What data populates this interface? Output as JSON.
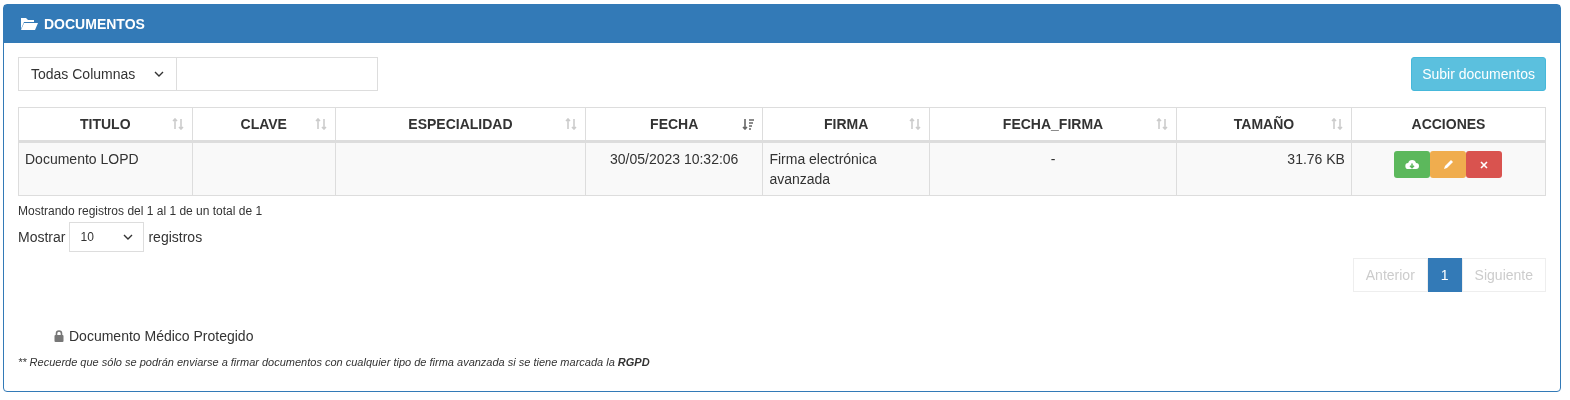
{
  "panel": {
    "title": "DOCUMENTOS"
  },
  "filter": {
    "column_select": "Todas Columnas"
  },
  "upload_button": "Subir documentos",
  "table": {
    "columns": [
      {
        "label": "TITULO",
        "sortable": true,
        "sorted": false
      },
      {
        "label": "CLAVE",
        "sortable": true,
        "sorted": false
      },
      {
        "label": "ESPECIALIDAD",
        "sortable": true,
        "sorted": false
      },
      {
        "label": "FECHA",
        "sortable": true,
        "sorted": true
      },
      {
        "label": "FIRMA",
        "sortable": true,
        "sorted": false
      },
      {
        "label": "FECHA_FIRMA",
        "sortable": true,
        "sorted": false
      },
      {
        "label": "TAMAÑO",
        "sortable": true,
        "sorted": false
      },
      {
        "label": "ACCIONES",
        "sortable": false,
        "sorted": false
      }
    ],
    "rows": [
      {
        "cells": [
          "Documento LOPD",
          "",
          "",
          "30/05/2023 10:32:06",
          "Firma electrónica avanzada",
          "-",
          "31.76 KB"
        ],
        "actions": [
          {
            "kind": "download",
            "color": "#5cb85c"
          },
          {
            "kind": "edit",
            "color": "#f0ad4e"
          },
          {
            "kind": "delete",
            "color": "#d9534f"
          }
        ]
      }
    ]
  },
  "info": "Mostrando registros del 1 al 1 de un total de 1",
  "length": {
    "before": "Mostrar",
    "value": "10",
    "after": "registros"
  },
  "pagination": [
    {
      "label": "Anterior",
      "selected": false,
      "disabled": true
    },
    {
      "label": "1",
      "selected": true,
      "disabled": false
    },
    {
      "label": "Siguiente",
      "selected": false,
      "disabled": true
    }
  ],
  "protected_label": "Documento Médico Protegido",
  "note": "** Recuerde que sólo se podrán enviarse a firmar documentos con cualquier tipo de firma avanzada si se tiene marcada la **RGPD**"
}
